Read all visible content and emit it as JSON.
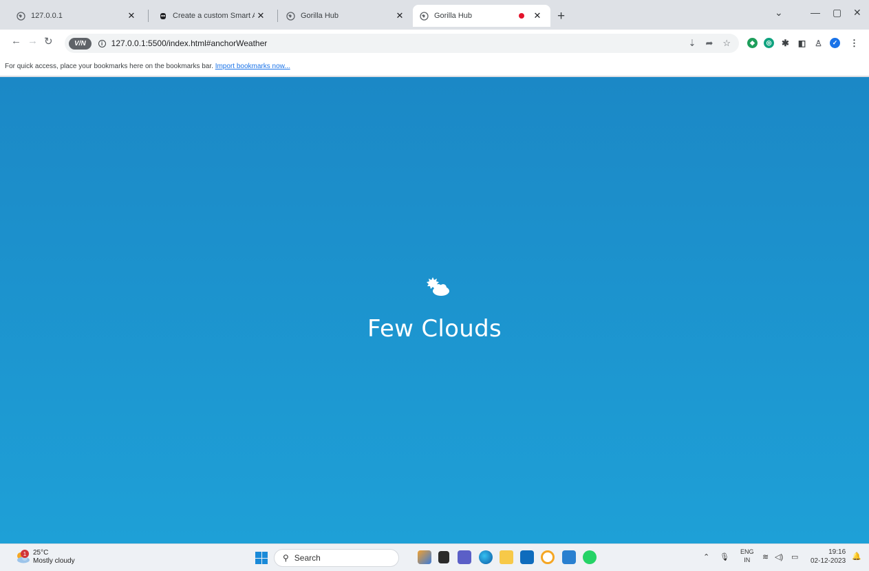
{
  "browser": {
    "tabs": [
      {
        "title": "127.0.0.1",
        "active": false
      },
      {
        "title": "Create a custom Smart Assistant",
        "active": false
      },
      {
        "title": "Gorilla Hub",
        "active": false
      },
      {
        "title": "Gorilla Hub",
        "active": true
      }
    ],
    "url": "127.0.0.1:5500/index.html#anchorWeather",
    "vpn_label": "V/N",
    "bookmarks_text": "For quick access, place your bookmarks here on the bookmarks bar.",
    "bookmarks_link": "Import bookmarks now..."
  },
  "weather": {
    "description": "Few Clouds",
    "icon": "few-clouds-icon"
  },
  "taskbar": {
    "weather_temp": "25°C",
    "weather_desc": "Mostly cloudy",
    "weather_badge": "1",
    "search_label": "Search",
    "lang_top": "ENG",
    "lang_bottom": "IN",
    "time": "19:16",
    "date": "02-12-2023"
  },
  "colors": {
    "sky_top": "#1b88c6",
    "sky_bottom": "#1ea0d7"
  }
}
